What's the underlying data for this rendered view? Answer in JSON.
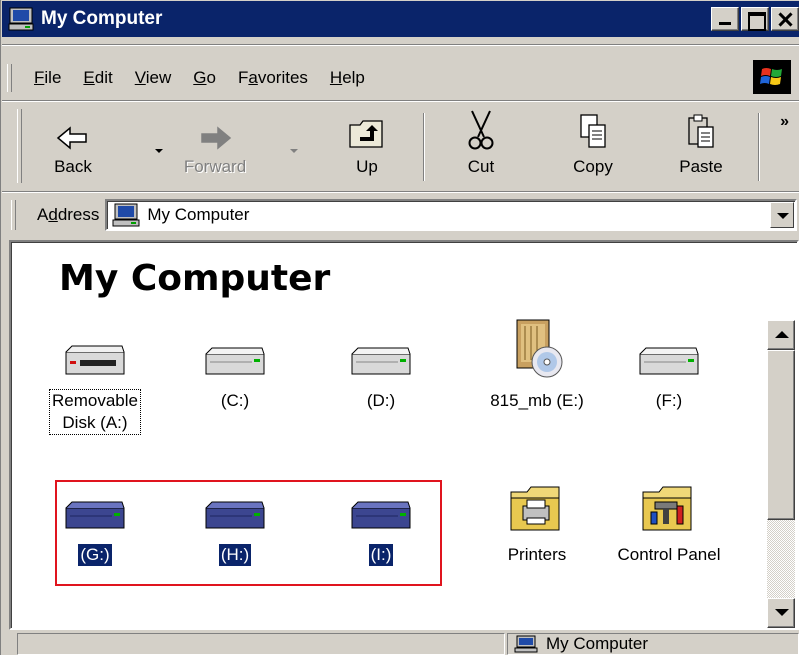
{
  "window": {
    "title": "My Computer"
  },
  "menu": [
    {
      "label": "File",
      "key": "F",
      "rest": "ile"
    },
    {
      "label": "Edit",
      "key": "E",
      "rest": "dit"
    },
    {
      "label": "View",
      "key": "V",
      "rest": "iew"
    },
    {
      "label": "Go",
      "key": "G",
      "rest": "o"
    },
    {
      "label": "Favorites",
      "pre": "F",
      "key": "a",
      "rest": "vorites"
    },
    {
      "label": "Help",
      "key": "H",
      "rest": "elp"
    }
  ],
  "toolbar": {
    "back": "Back",
    "forward": "Forward",
    "up": "Up",
    "cut": "Cut",
    "copy": "Copy",
    "paste": "Paste",
    "more": "»"
  },
  "address": {
    "label_pre": "A",
    "label_key": "d",
    "label_rest": "dress",
    "value": "My Computer"
  },
  "content": {
    "title": "My Computer",
    "items": [
      {
        "label_line1": "Removable",
        "label_line2": "Disk (A:)",
        "icon": "floppy-drive-icon"
      },
      {
        "label": "(C:)",
        "icon": "hard-drive-icon"
      },
      {
        "label": "(D:)",
        "icon": "hard-drive-icon"
      },
      {
        "label": "815_mb (E:)",
        "icon": "cd-drive-icon"
      },
      {
        "label": "(F:)",
        "icon": "hard-drive-icon"
      },
      {
        "label": "(G:)",
        "icon": "hard-drive-icon",
        "selected": true
      },
      {
        "label": "(H:)",
        "icon": "hard-drive-icon",
        "selected": true
      },
      {
        "label": "(I:)",
        "icon": "hard-drive-icon",
        "selected": true
      },
      {
        "label": "Printers",
        "icon": "printers-folder-icon"
      },
      {
        "label": "Control Panel",
        "icon": "control-panel-folder-icon"
      }
    ]
  },
  "status": {
    "left": "",
    "right": "My Computer"
  },
  "colors": {
    "titlebar": "#0a246a",
    "selection": "#0a246a",
    "highlight_box": "#e0141e",
    "face": "#d4d0c8"
  }
}
